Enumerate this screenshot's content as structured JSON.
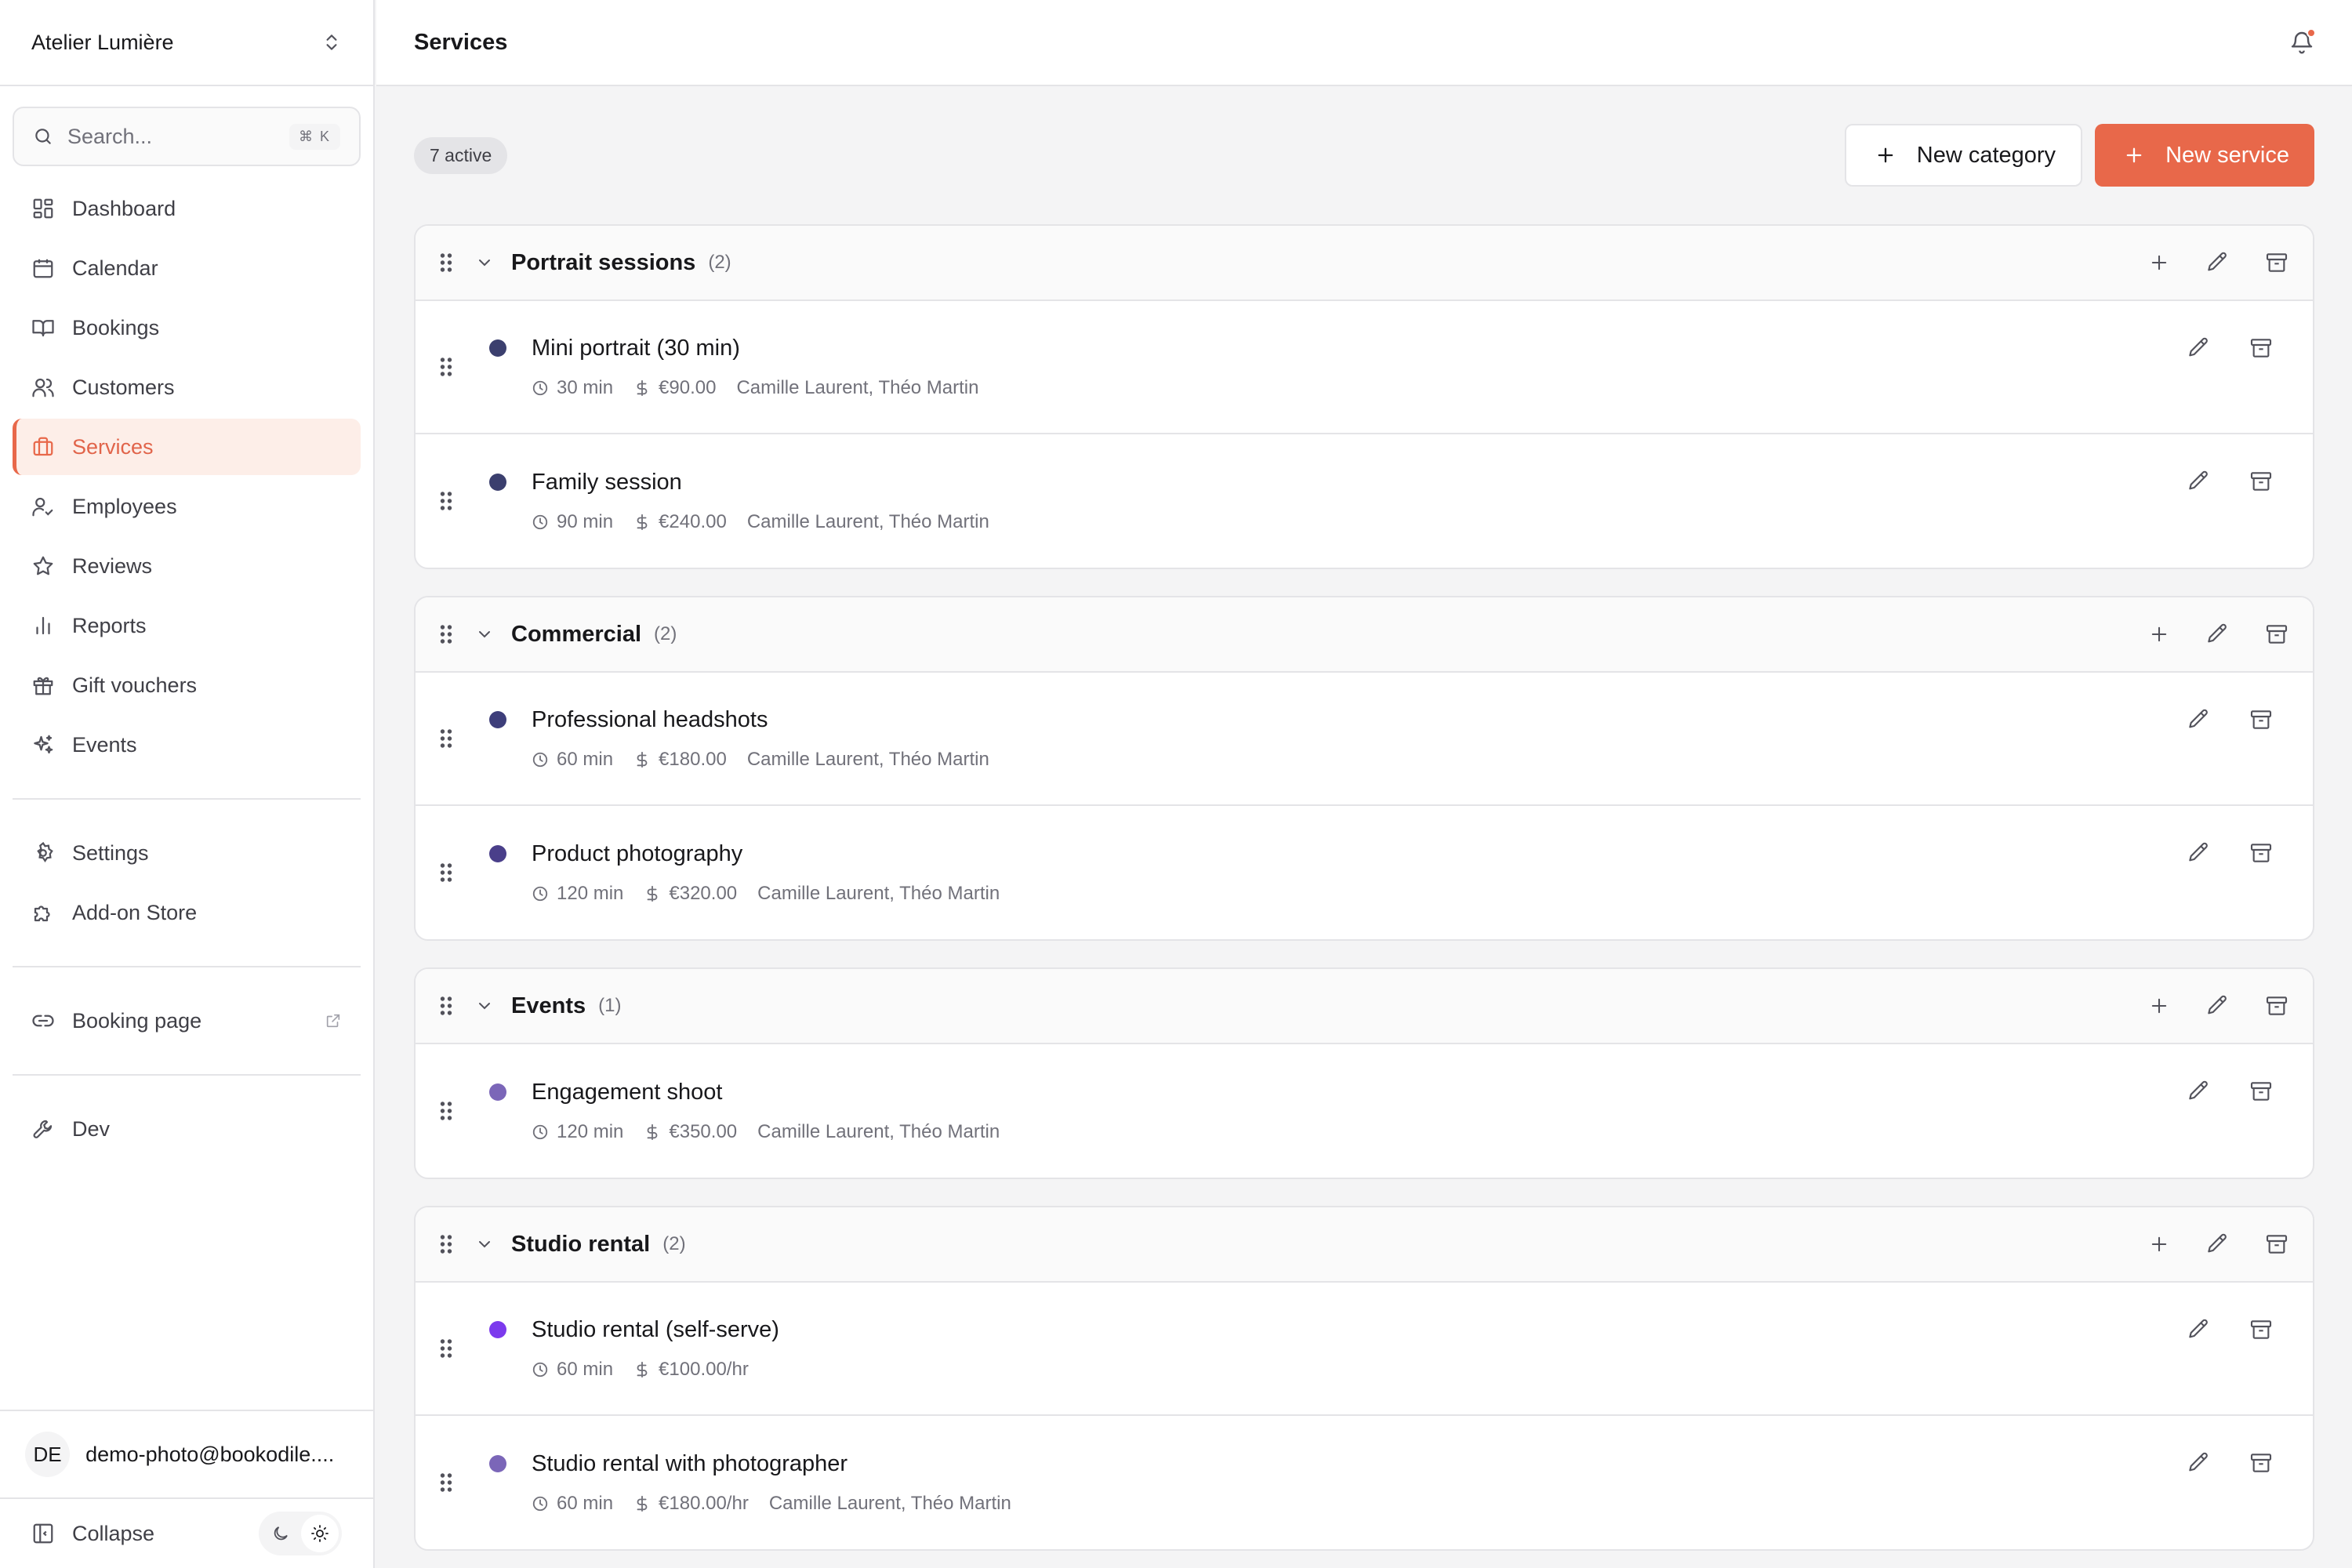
{
  "sidebar": {
    "org_name": "Atelier Lumière",
    "search": {
      "placeholder": "Search...",
      "shortcut": "⌘ K"
    },
    "nav": [
      {
        "label": "Dashboard",
        "icon": "dashboard-icon"
      },
      {
        "label": "Calendar",
        "icon": "calendar-icon"
      },
      {
        "label": "Bookings",
        "icon": "book-icon"
      },
      {
        "label": "Customers",
        "icon": "users-icon"
      },
      {
        "label": "Services",
        "icon": "briefcase-icon",
        "active": true
      },
      {
        "label": "Employees",
        "icon": "user-check-icon"
      },
      {
        "label": "Reviews",
        "icon": "star-icon"
      },
      {
        "label": "Reports",
        "icon": "bar-chart-icon"
      },
      {
        "label": "Gift vouchers",
        "icon": "gift-icon"
      },
      {
        "label": "Events",
        "icon": "sparkles-icon"
      }
    ],
    "nav_secondary": [
      {
        "label": "Settings",
        "icon": "gear-icon"
      },
      {
        "label": "Add-on Store",
        "icon": "puzzle-icon"
      }
    ],
    "booking_page": {
      "label": "Booking page",
      "icon": "link-icon"
    },
    "dev": {
      "label": "Dev",
      "icon": "wrench-icon"
    },
    "user": {
      "initials": "DE",
      "email": "demo-photo@bookodile...."
    },
    "collapse_label": "Collapse"
  },
  "header": {
    "title": "Services"
  },
  "toolbar": {
    "active_badge": "7 active",
    "new_category_label": "New category",
    "new_service_label": "New service"
  },
  "colors": {
    "accent": "#e8684a",
    "accent_bg": "#fdeee8"
  },
  "categories": [
    {
      "name": "Portrait sessions",
      "count": "(2)",
      "services": [
        {
          "name": "Mini portrait (30 min)",
          "color": "#3b3f6e",
          "duration": "30 min",
          "price": "€90.00",
          "staff": "Camille Laurent, Théo Martin"
        },
        {
          "name": "Family session",
          "color": "#3b3f6e",
          "duration": "90 min",
          "price": "€240.00",
          "staff": "Camille Laurent, Théo Martin"
        }
      ]
    },
    {
      "name": "Commercial",
      "count": "(2)",
      "services": [
        {
          "name": "Professional headshots",
          "color": "#3d3e7a",
          "duration": "60 min",
          "price": "€180.00",
          "staff": "Camille Laurent, Théo Martin"
        },
        {
          "name": "Product photography",
          "color": "#4a3f8a",
          "duration": "120 min",
          "price": "€320.00",
          "staff": "Camille Laurent, Théo Martin"
        }
      ]
    },
    {
      "name": "Events",
      "count": "(1)",
      "services": [
        {
          "name": "Engagement shoot",
          "color": "#7b66b8",
          "duration": "120 min",
          "price": "€350.00",
          "staff": "Camille Laurent, Théo Martin"
        }
      ]
    },
    {
      "name": "Studio rental",
      "count": "(2)",
      "services": [
        {
          "name": "Studio rental (self-serve)",
          "color": "#7c3aed",
          "duration": "60 min",
          "price": "€100.00/hr",
          "staff": ""
        },
        {
          "name": "Studio rental with photographer",
          "color": "#7b66b8",
          "duration": "60 min",
          "price": "€180.00/hr",
          "staff": "Camille Laurent, Théo Martin"
        }
      ]
    }
  ]
}
